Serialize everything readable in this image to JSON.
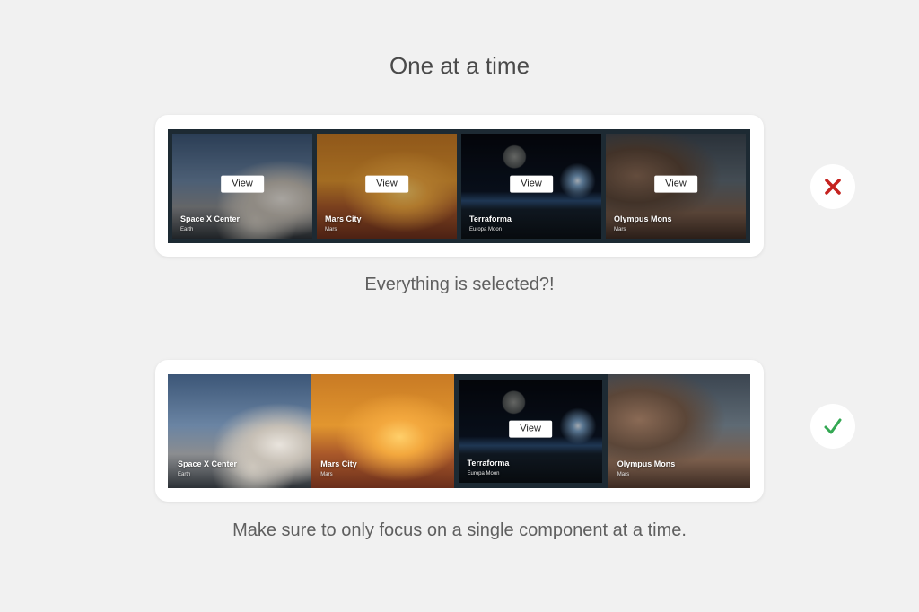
{
  "title": "One at a time",
  "bad_example": {
    "caption": "Everything is selected?!",
    "status_icon": "cross-icon",
    "status_color": "#c5221f",
    "cards": [
      {
        "name": "Space X Center",
        "subtitle": "Earth",
        "button": "View"
      },
      {
        "name": "Mars City",
        "subtitle": "Mars",
        "button": "View"
      },
      {
        "name": "Terraforma",
        "subtitle": "Europa Moon",
        "button": "View"
      },
      {
        "name": "Olympus Mons",
        "subtitle": "Mars",
        "button": "View"
      }
    ]
  },
  "good_example": {
    "caption": "Make sure to only focus on a single component at a time.",
    "status_icon": "checkmark-icon",
    "status_color": "#34a853",
    "focused_card": "Terraforma",
    "cards": [
      {
        "name": "Space X Center",
        "subtitle": "Earth"
      },
      {
        "name": "Mars City",
        "subtitle": "Mars"
      },
      {
        "name": "Terraforma",
        "subtitle": "Europa Moon",
        "button": "View"
      },
      {
        "name": "Olympus Mons",
        "subtitle": "Mars"
      }
    ]
  }
}
